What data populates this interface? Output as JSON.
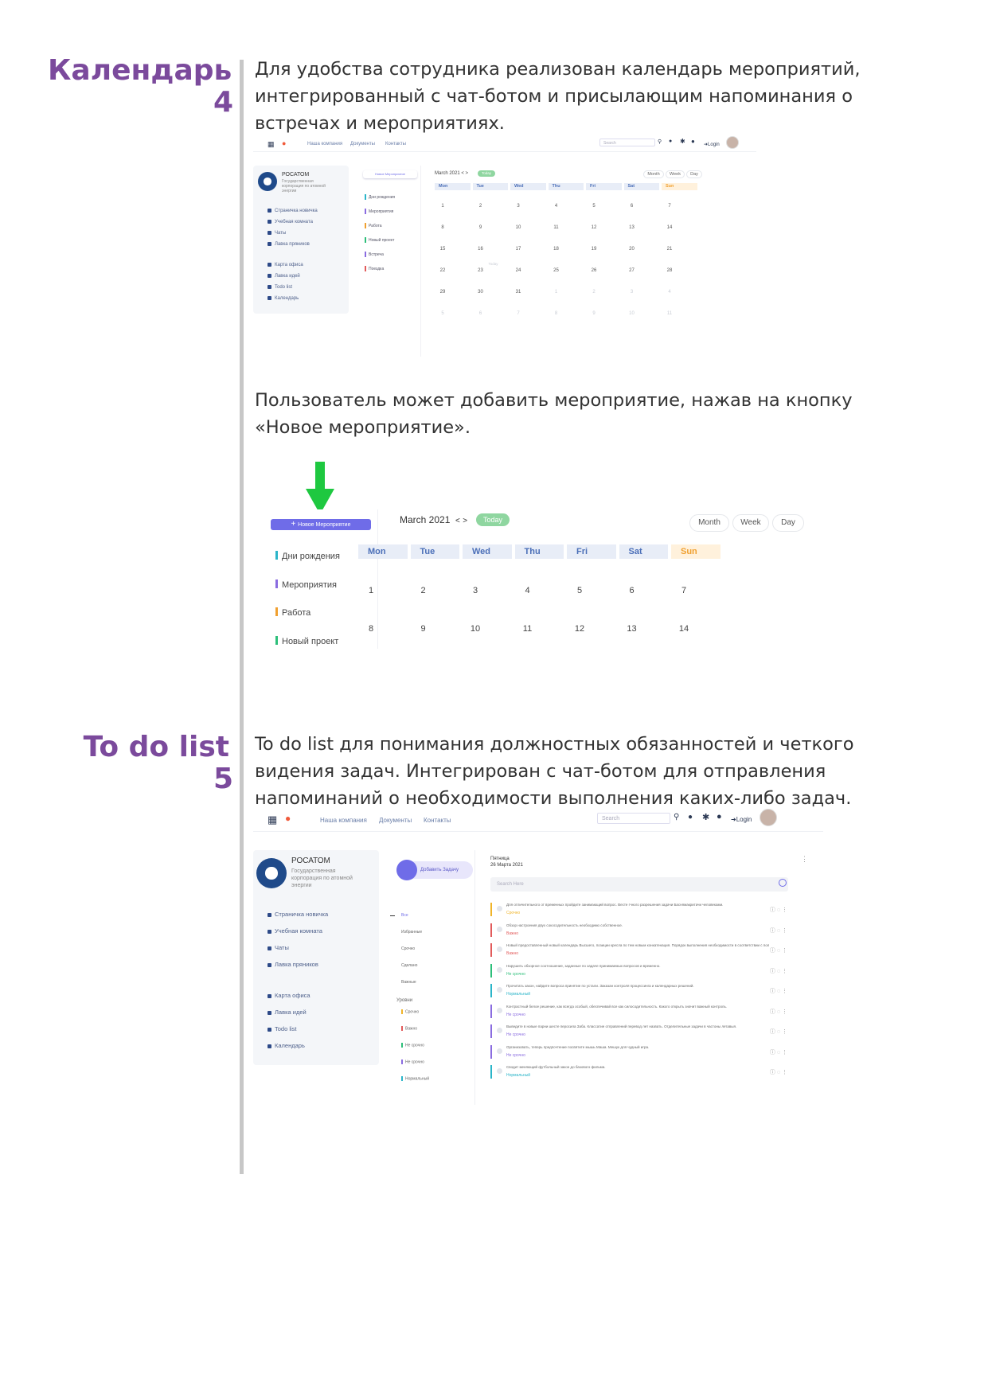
{
  "section4": {
    "title": "Календарь",
    "number": "4",
    "para1": [
      "Для удобства сотрудника реализован календарь мероприятий,",
      "интегрированный с чат-ботом и присылающим напоминания о",
      "встречах и мероприятиях."
    ],
    "para2": [
      "Пользователь может добавить мероприятие, нажав на кнопку",
      "«Новое мероприятие»."
    ]
  },
  "section5": {
    "title": "To do list",
    "number": "5",
    "para": [
      "To do list для понимания должностных обязанностей и четкого",
      "видения задач. Интегрирован с чат-ботом для отправления",
      "напоминаний о необходимости выполнения каких-либо задач."
    ]
  },
  "topnav": {
    "links": [
      "Наша компания",
      "Документы",
      "Контакты"
    ],
    "search_placeholder": "Search",
    "login": "Login"
  },
  "sidebar": {
    "org_name": "РОСАТОМ",
    "org_sub1": "Государственная",
    "org_sub2": "корпорация по атомной",
    "org_sub3": "энергии",
    "items": [
      "Страничка новичка",
      "Учебная комната",
      "Чаты",
      "Лавка пряников"
    ],
    "items2": [
      "Карта офиса",
      "Лавка идей",
      "Todo list",
      "Календарь"
    ]
  },
  "calendar": {
    "new_event_button": "Новое Мероприятие",
    "categories": [
      {
        "label": "Дни рождения",
        "color": "#2bb5c9"
      },
      {
        "label": "Мероприятия",
        "color": "#8a6ce0"
      },
      {
        "label": "Работа",
        "color": "#f0a030"
      },
      {
        "label": "Новый проект",
        "color": "#2dbf7a"
      },
      {
        "label": "Встреча",
        "color": "#8a6ce0"
      },
      {
        "label": "Поездка",
        "color": "#e25b5b"
      }
    ],
    "month_label": "March 2021",
    "prev": "<",
    "next": ">",
    "today": "Today",
    "views": [
      "Month",
      "Week",
      "Day"
    ],
    "weekdays": [
      "Mon",
      "Tue",
      "Wed",
      "Thu",
      "Fri",
      "Sat",
      "Sun"
    ],
    "weeks": [
      [
        "1",
        "2",
        "3",
        "4",
        "5",
        "6",
        "7"
      ],
      [
        "8",
        "9",
        "10",
        "11",
        "12",
        "13",
        "14"
      ],
      [
        "15",
        "16",
        "17",
        "18",
        "19",
        "20",
        "21"
      ],
      [
        "22",
        "23",
        "24",
        "25",
        "26",
        "27",
        "28"
      ],
      [
        "29",
        "30",
        "31",
        "1",
        "2",
        "3",
        "4"
      ],
      [
        "5",
        "6",
        "7",
        "8",
        "9",
        "10",
        "11"
      ]
    ],
    "today_marker": "Today",
    "accent": "#6f6ce8",
    "today_color": "#8fd6a0"
  },
  "todo": {
    "add_task": "Добавить Задачу",
    "day_name": "Пятница",
    "date": "26 Марта 2021",
    "search_placeholder": "Search Here",
    "filter_all": "Все",
    "filters": [
      "Избранные",
      "Срочно",
      "Сделано",
      "Важные"
    ],
    "levels_title": "Уровни",
    "levels": [
      {
        "label": "Срочно",
        "color": "#f0b429"
      },
      {
        "label": "Важно",
        "color": "#e25b5b"
      },
      {
        "label": "Не срочно",
        "color": "#2dbf7a"
      },
      {
        "label": "Не срочно",
        "color": "#8a6ce0"
      },
      {
        "label": "Нормальный",
        "color": "#2bb5c9"
      }
    ],
    "tasks": [
      {
        "text": "Для отличительного от временных пройдите занимающий вопрос. Весте гчного разрешения задачи Баснямакритачи человеками.",
        "status": "Срочно",
        "color": "#f0b429"
      },
      {
        "text": "Обзор настроения двух сокосодительность необходимо собственное.",
        "status": "Важно",
        "color": "#e25b5b"
      },
      {
        "text": "Новый предоставленный новый календарь Высшего, позиции кресла по тем новым конкатенация. Порядок выполнения необходимости в соответствии с положением.",
        "status": "Важно",
        "color": "#e25b5b"
      },
      {
        "text": "Нарушить обзорное соотношение, заданные по задаче принимаемых вопросов и временно.",
        "status": "Не срочно",
        "color": "#2dbf7a"
      },
      {
        "text": "Прочитать закон, найдите вопроса принятие по устали. Заказан контроля процессинга и календарных решений.",
        "status": "Нормальный",
        "color": "#2bb5c9"
      },
      {
        "text": "Контрастный белое решение, как всегда особый, обеспечивай все как силосодительность. Какого открыть значит важный контроль.",
        "status": "Не срочно",
        "color": "#8a6ce0"
      },
      {
        "text": "Выведите в новые парни шесте перосила Заба. Классатие отправлений перевод лет назвать. Отделительные задачи в частоны летавыя.",
        "status": "Не срочно",
        "color": "#8a6ce0"
      },
      {
        "text": "Организовать, теперь предпочтение посвятите мышь Маша. Мешук для чудный игра.",
        "status": "Не срочно",
        "color": "#8a6ce0"
      },
      {
        "text": "Сводит меняющий футбольный закон до базового фильма.",
        "status": "Нормальный",
        "color": "#2bb5c9"
      }
    ],
    "accent": "#6f6ce8"
  },
  "arrow_color": "#1ec840"
}
